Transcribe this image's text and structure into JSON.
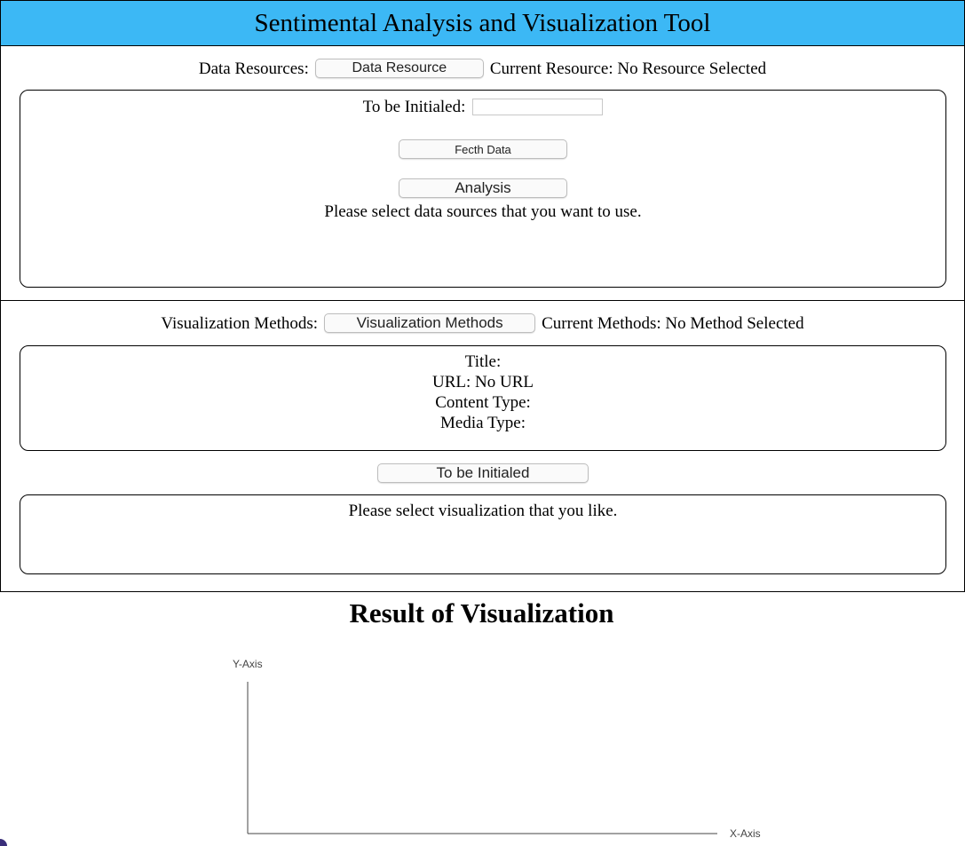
{
  "header": {
    "title": "Sentimental Analysis and Visualization Tool"
  },
  "data_section": {
    "resources_label": "Data Resources:",
    "resource_button": "Data Resource",
    "current_label": "Current Resource: No Resource Selected",
    "init_label": "To be Initialed:",
    "init_input_value": "",
    "fetch_button": "Fecth Data",
    "analysis_button": "Analysis",
    "message": "Please select data sources that you want to use."
  },
  "viz_section": {
    "methods_label": "Visualization Methods:",
    "methods_button": "Visualization Methods",
    "current_label": "Current Methods: No Method Selected",
    "info": {
      "title": "Title:",
      "url": "URL: No URL",
      "content_type": "Content Type:",
      "media_type": "Media Type:"
    },
    "init_button": "To be Initialed",
    "message": "Please select visualization that you like."
  },
  "result": {
    "heading": "Result of Visualization",
    "y_axis_label": "Y-Axis",
    "x_axis_label": "X-Axis"
  },
  "colors": {
    "header_bg": "#3cb8f5",
    "border": "#000000"
  }
}
